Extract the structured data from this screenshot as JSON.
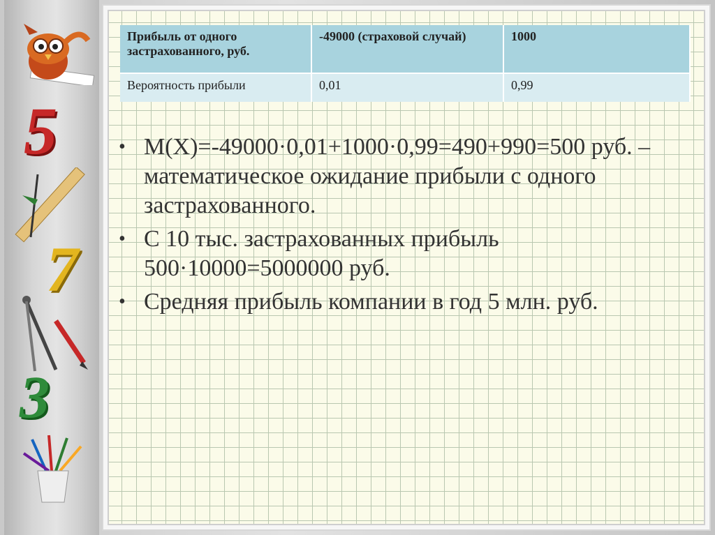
{
  "table": {
    "header": [
      "Прибыль от одного застрахованного, руб.",
      "-49000 (страховой случай)",
      "1000"
    ],
    "row": [
      "Вероятность прибыли",
      "0,01",
      "0,99"
    ]
  },
  "bullets": [
    "M(X)=-49000·0,01+1000·0,99=490+990=500 руб. – математическое ожидание прибыли с одного застрахованного.",
    "С 10 тыс. застрахованных прибыль 500·10000=5000000 руб.",
    "Средняя прибыль компании в год 5 млн. руб."
  ],
  "sidebar": {
    "digit_top": "5",
    "digit_mid": "7",
    "digit_bot": "3",
    "icons": [
      "owl-icon",
      "ruler-icon",
      "compass-icon",
      "pencil-cup-icon"
    ]
  },
  "colors": {
    "header_cell": "#a8d3de",
    "row_cell": "#d9ecf1",
    "paper": "#fbfbe9",
    "grid": "#b9c7b0"
  }
}
